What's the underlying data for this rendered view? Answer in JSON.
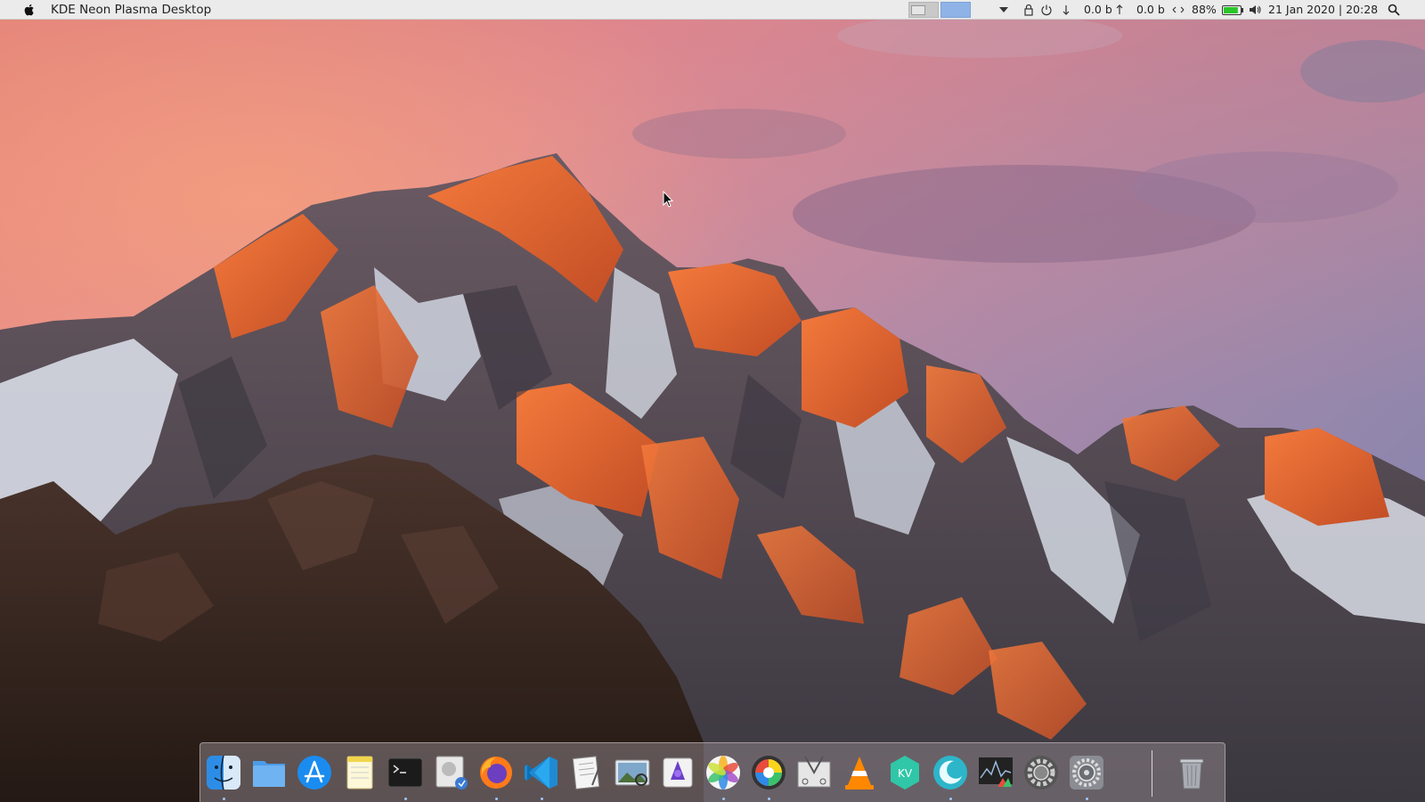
{
  "desktop": {
    "wallpaper": "mountain-range-at-sunset",
    "colors": {
      "sky_top": "#e9857a",
      "sky_mid": "#c98a9c",
      "sky_right": "#9c87b3",
      "snow": "#d9dde6",
      "rock_dark": "#3a2a26",
      "rock_lit": "#e0652e"
    }
  },
  "topbar": {
    "app_icon": "apple-logo-icon",
    "app_title": "KDE Neon Plasma Desktop",
    "pager": {
      "desktops": [
        "desktop-1",
        "desktop-2"
      ],
      "active": 2
    },
    "tray": {
      "download_rate": "0.0 b",
      "upload_rate": "0.0 b",
      "battery": "88%",
      "battery_level": 0.88,
      "clock": "21 Jan 2020 | 20:28",
      "icons": [
        "expand-tray-icon",
        "lock-icon",
        "power-icon",
        "download-arrow-icon",
        "upload-arrow-icon",
        "network-icon",
        "battery-icon",
        "volume-icon",
        "search-icon"
      ]
    }
  },
  "dock": {
    "apps": [
      {
        "name": "finder-icon",
        "running": true
      },
      {
        "name": "folder-icon",
        "running": false
      },
      {
        "name": "app-store-icon",
        "running": false
      },
      {
        "name": "notes-icon",
        "running": false
      },
      {
        "name": "terminal-icon",
        "running": true
      },
      {
        "name": "preview-icon",
        "running": false
      },
      {
        "name": "firefox-icon",
        "running": true
      },
      {
        "name": "vscode-icon",
        "running": true
      },
      {
        "name": "text-editor-icon",
        "running": false
      },
      {
        "name": "image-viewer-icon",
        "running": false
      },
      {
        "name": "wizard-app-icon",
        "running": false
      },
      {
        "name": "photos-icon",
        "running": true
      },
      {
        "name": "color-picker-icon",
        "running": true
      },
      {
        "name": "screenshot-icon",
        "running": false
      },
      {
        "name": "vlc-icon",
        "running": false
      },
      {
        "name": "kvantum-icon",
        "running": false
      },
      {
        "name": "moon-app-icon",
        "running": true
      },
      {
        "name": "system-monitor-icon",
        "running": false
      },
      {
        "name": "settings-gear-icon",
        "running": false
      },
      {
        "name": "system-preferences-icon",
        "running": true
      }
    ],
    "trash": "trash-icon"
  }
}
